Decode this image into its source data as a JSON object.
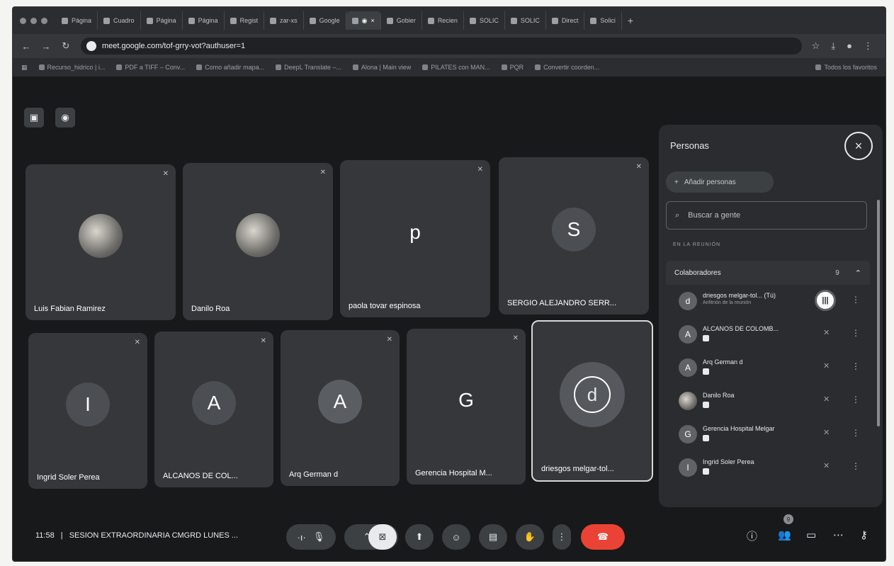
{
  "browser": {
    "tabs": [
      {
        "label": "Página",
        "active": false
      },
      {
        "label": "Cuadro",
        "active": false
      },
      {
        "label": "Página",
        "active": false
      },
      {
        "label": "Página",
        "active": false
      },
      {
        "label": "Regist",
        "active": false
      },
      {
        "label": "zar-xs",
        "active": false
      },
      {
        "label": "Google",
        "active": false
      },
      {
        "label": "",
        "active": true
      },
      {
        "label": "Gobier",
        "active": false
      },
      {
        "label": "Recien",
        "active": false
      },
      {
        "label": "SOLIC",
        "active": false
      },
      {
        "label": "SOLIC",
        "active": false
      },
      {
        "label": "Direct",
        "active": false
      },
      {
        "label": "Solici",
        "active": false
      }
    ],
    "url": "meet.google.com/tof-grry-vot?authuser=1",
    "bookmarks": [
      "Recurso_hidrico | i...",
      "PDF a TIFF – Conv...",
      "Como añadir mapa...",
      "DeepL Translate –...",
      "Alona | Main view",
      "PILATES con MAN...",
      "PQR",
      "Convertir coorden...",
      "Todos los favoritos"
    ]
  },
  "meet": {
    "participants": [
      {
        "name": "Luis Fabian Ramirez",
        "initial": ""
      },
      {
        "name": "Danilo Roa",
        "initial": ""
      },
      {
        "name": "paola tovar espinosa",
        "initial": "p"
      },
      {
        "name": "SERGIO ALEJANDRO SERR...",
        "initial": "S"
      },
      {
        "name": "Ingrid Soler Perea",
        "initial": "I"
      },
      {
        "name": "ALCANOS DE COL...",
        "initial": "A"
      },
      {
        "name": "Arq German d",
        "initial": "A"
      },
      {
        "name": "Gerencia Hospital M...",
        "initial": "G"
      },
      {
        "name": "driesgos melgar-tol...",
        "initial": "d"
      }
    ],
    "panel": {
      "title": "Personas",
      "add_people": "Añadir personas",
      "search_placeholder": "Buscar a gente",
      "section": "EN LA REUNIÓN",
      "group": "Colaboradores",
      "group_count": "9",
      "people": [
        {
          "name": "driesgos melgar-tol... (Tú)",
          "sub": "Anfitrión de la reunión",
          "initial": "d"
        },
        {
          "name": "ALCANOS DE COLOMB...",
          "sub": "",
          "initial": "A"
        },
        {
          "name": "Arq German d",
          "sub": "",
          "initial": "A"
        },
        {
          "name": "Danilo Roa",
          "sub": "",
          "initial": ""
        },
        {
          "name": "Gerencia Hospital Melgar",
          "sub": "",
          "initial": "G"
        },
        {
          "name": "Ingrid Soler Perea",
          "sub": "",
          "initial": "I"
        }
      ]
    },
    "bottom": {
      "time": "11:58",
      "separator": "|",
      "meeting_title": "SESION EXTRAORDINARIA CMGRD LUNES ...",
      "people_badge": "9"
    }
  }
}
